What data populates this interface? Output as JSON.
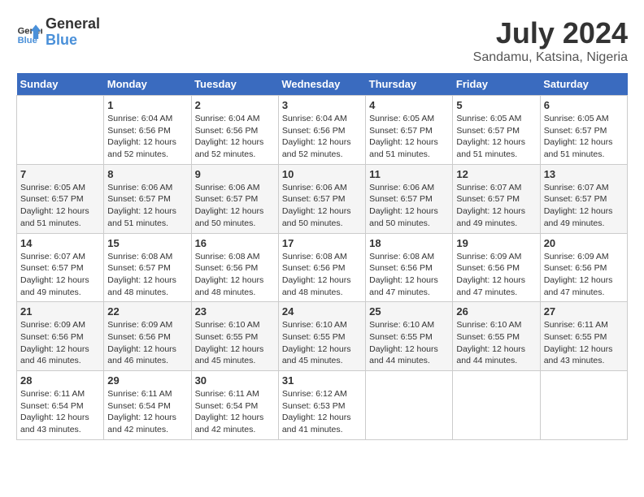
{
  "header": {
    "logo_line1": "General",
    "logo_line2": "Blue",
    "month_title": "July 2024",
    "location": "Sandamu, Katsina, Nigeria"
  },
  "days_of_week": [
    "Sunday",
    "Monday",
    "Tuesday",
    "Wednesday",
    "Thursday",
    "Friday",
    "Saturday"
  ],
  "weeks": [
    [
      {
        "day": "",
        "sunrise": "",
        "sunset": "",
        "daylight": ""
      },
      {
        "day": "1",
        "sunrise": "6:04 AM",
        "sunset": "6:56 PM",
        "daylight": "12 hours and 52 minutes."
      },
      {
        "day": "2",
        "sunrise": "6:04 AM",
        "sunset": "6:56 PM",
        "daylight": "12 hours and 52 minutes."
      },
      {
        "day": "3",
        "sunrise": "6:04 AM",
        "sunset": "6:56 PM",
        "daylight": "12 hours and 52 minutes."
      },
      {
        "day": "4",
        "sunrise": "6:05 AM",
        "sunset": "6:57 PM",
        "daylight": "12 hours and 51 minutes."
      },
      {
        "day": "5",
        "sunrise": "6:05 AM",
        "sunset": "6:57 PM",
        "daylight": "12 hours and 51 minutes."
      },
      {
        "day": "6",
        "sunrise": "6:05 AM",
        "sunset": "6:57 PM",
        "daylight": "12 hours and 51 minutes."
      }
    ],
    [
      {
        "day": "7",
        "sunrise": "6:05 AM",
        "sunset": "6:57 PM",
        "daylight": "12 hours and 51 minutes."
      },
      {
        "day": "8",
        "sunrise": "6:06 AM",
        "sunset": "6:57 PM",
        "daylight": "12 hours and 51 minutes."
      },
      {
        "day": "9",
        "sunrise": "6:06 AM",
        "sunset": "6:57 PM",
        "daylight": "12 hours and 50 minutes."
      },
      {
        "day": "10",
        "sunrise": "6:06 AM",
        "sunset": "6:57 PM",
        "daylight": "12 hours and 50 minutes."
      },
      {
        "day": "11",
        "sunrise": "6:06 AM",
        "sunset": "6:57 PM",
        "daylight": "12 hours and 50 minutes."
      },
      {
        "day": "12",
        "sunrise": "6:07 AM",
        "sunset": "6:57 PM",
        "daylight": "12 hours and 49 minutes."
      },
      {
        "day": "13",
        "sunrise": "6:07 AM",
        "sunset": "6:57 PM",
        "daylight": "12 hours and 49 minutes."
      }
    ],
    [
      {
        "day": "14",
        "sunrise": "6:07 AM",
        "sunset": "6:57 PM",
        "daylight": "12 hours and 49 minutes."
      },
      {
        "day": "15",
        "sunrise": "6:08 AM",
        "sunset": "6:57 PM",
        "daylight": "12 hours and 48 minutes."
      },
      {
        "day": "16",
        "sunrise": "6:08 AM",
        "sunset": "6:56 PM",
        "daylight": "12 hours and 48 minutes."
      },
      {
        "day": "17",
        "sunrise": "6:08 AM",
        "sunset": "6:56 PM",
        "daylight": "12 hours and 48 minutes."
      },
      {
        "day": "18",
        "sunrise": "6:08 AM",
        "sunset": "6:56 PM",
        "daylight": "12 hours and 47 minutes."
      },
      {
        "day": "19",
        "sunrise": "6:09 AM",
        "sunset": "6:56 PM",
        "daylight": "12 hours and 47 minutes."
      },
      {
        "day": "20",
        "sunrise": "6:09 AM",
        "sunset": "6:56 PM",
        "daylight": "12 hours and 47 minutes."
      }
    ],
    [
      {
        "day": "21",
        "sunrise": "6:09 AM",
        "sunset": "6:56 PM",
        "daylight": "12 hours and 46 minutes."
      },
      {
        "day": "22",
        "sunrise": "6:09 AM",
        "sunset": "6:56 PM",
        "daylight": "12 hours and 46 minutes."
      },
      {
        "day": "23",
        "sunrise": "6:10 AM",
        "sunset": "6:55 PM",
        "daylight": "12 hours and 45 minutes."
      },
      {
        "day": "24",
        "sunrise": "6:10 AM",
        "sunset": "6:55 PM",
        "daylight": "12 hours and 45 minutes."
      },
      {
        "day": "25",
        "sunrise": "6:10 AM",
        "sunset": "6:55 PM",
        "daylight": "12 hours and 44 minutes."
      },
      {
        "day": "26",
        "sunrise": "6:10 AM",
        "sunset": "6:55 PM",
        "daylight": "12 hours and 44 minutes."
      },
      {
        "day": "27",
        "sunrise": "6:11 AM",
        "sunset": "6:55 PM",
        "daylight": "12 hours and 43 minutes."
      }
    ],
    [
      {
        "day": "28",
        "sunrise": "6:11 AM",
        "sunset": "6:54 PM",
        "daylight": "12 hours and 43 minutes."
      },
      {
        "day": "29",
        "sunrise": "6:11 AM",
        "sunset": "6:54 PM",
        "daylight": "12 hours and 42 minutes."
      },
      {
        "day": "30",
        "sunrise": "6:11 AM",
        "sunset": "6:54 PM",
        "daylight": "12 hours and 42 minutes."
      },
      {
        "day": "31",
        "sunrise": "6:12 AM",
        "sunset": "6:53 PM",
        "daylight": "12 hours and 41 minutes."
      },
      {
        "day": "",
        "sunrise": "",
        "sunset": "",
        "daylight": ""
      },
      {
        "day": "",
        "sunrise": "",
        "sunset": "",
        "daylight": ""
      },
      {
        "day": "",
        "sunrise": "",
        "sunset": "",
        "daylight": ""
      }
    ]
  ]
}
